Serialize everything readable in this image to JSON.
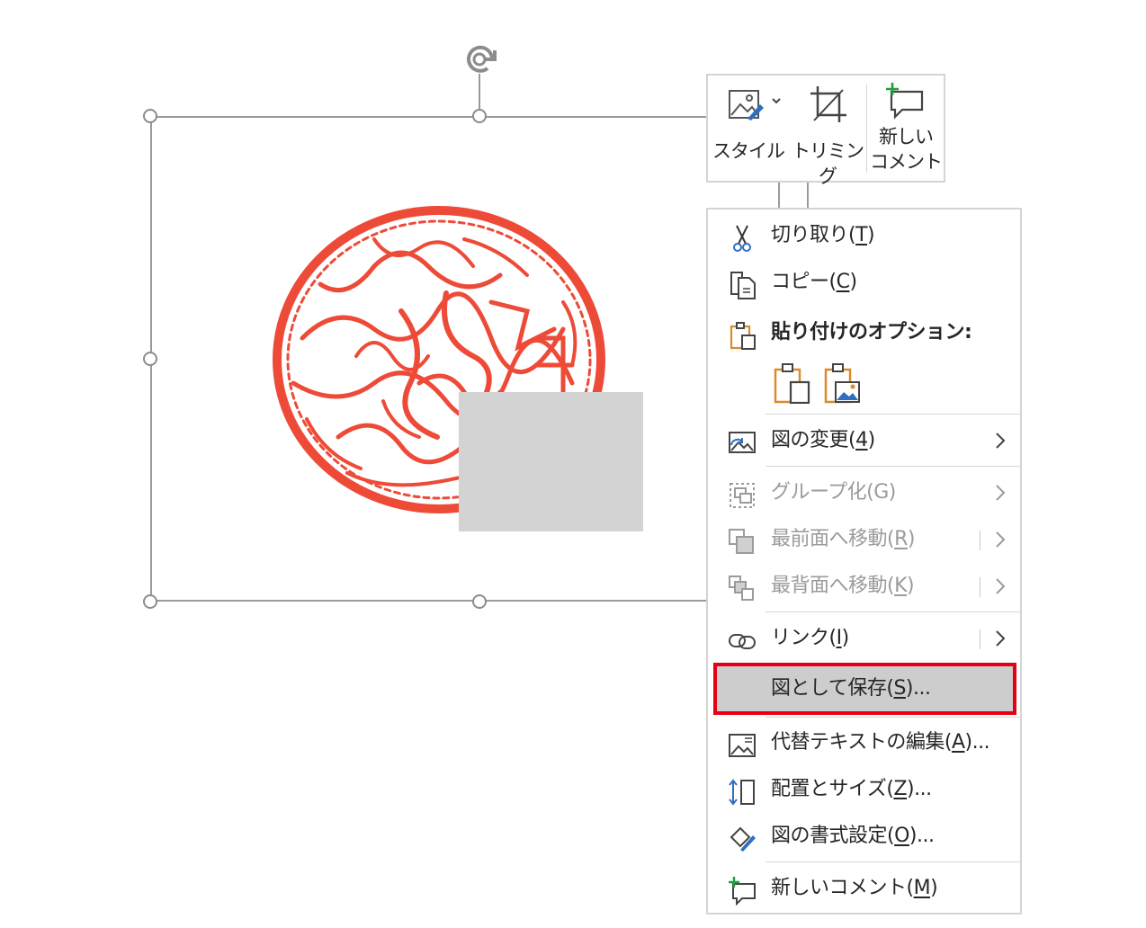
{
  "mini_toolbar": {
    "style_label": "スタイル",
    "trim_label": "トリミング",
    "new_comment_label": "新しい\nコメント"
  },
  "context_menu": {
    "cut": {
      "label": "切り取り(",
      "key": "T",
      "end": ")"
    },
    "copy": {
      "label": "コピー(",
      "key": "C",
      "end": ")"
    },
    "paste_options": {
      "label": "貼り付けのオプション:"
    },
    "change_picture": {
      "label": "図の変更(",
      "key": "4",
      "end": ")"
    },
    "group": {
      "label": "グループ化(G)"
    },
    "bring_front": {
      "label": "最前面へ移動(",
      "key": "R",
      "end": ")"
    },
    "send_back": {
      "label": "最背面へ移動(",
      "key": "K",
      "end": ")"
    },
    "link": {
      "label": "リンク(",
      "key": "I",
      "end": ")"
    },
    "save_as_picture": {
      "label": "図として保存(",
      "key": "S",
      "end": ")..."
    },
    "edit_alt_text": {
      "label": "代替テキストの編集(",
      "key": "A",
      "end": ")..."
    },
    "size_position": {
      "label": "配置とサイズ(",
      "key": "Z",
      "end": ")..."
    },
    "format_picture": {
      "label": "図の書式設定(",
      "key": "O",
      "end": ")..."
    },
    "new_comment": {
      "label": "新しいコメント(",
      "key": "M",
      "end": ")"
    }
  },
  "colors": {
    "highlight_border": "#e60012",
    "stamp_red": "#ee4a38",
    "paste_orange": "#d98c2b",
    "accent_blue": "#2f6fbf",
    "accent_green": "#1e9e3c"
  }
}
